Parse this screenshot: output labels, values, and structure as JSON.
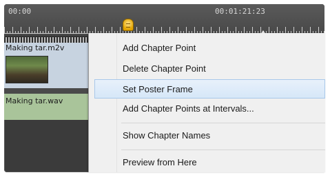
{
  "timeline": {
    "timecode_start": "00:00",
    "timecode_mid": "00:01:21:23"
  },
  "tracks": {
    "video_clip_name": "Making tar.m2v",
    "audio_clip_name": "Making tar.wav"
  },
  "context_menu": {
    "items": [
      "Add Chapter Point",
      "Delete Chapter Point",
      "Set Poster Frame",
      "Add Chapter Points at Intervals...",
      "Show Chapter Names",
      "Preview from Here"
    ],
    "selected": "Set Poster Frame"
  },
  "colors": {
    "highlight": "#d6e7f8",
    "video_track": "#c7d3e0",
    "audio_track": "#a9c49a",
    "playhead": "#e2a300",
    "chapter_marker": "#d43a3a"
  },
  "icons": [
    "playhead-icon",
    "chapter-marker-icon"
  ]
}
